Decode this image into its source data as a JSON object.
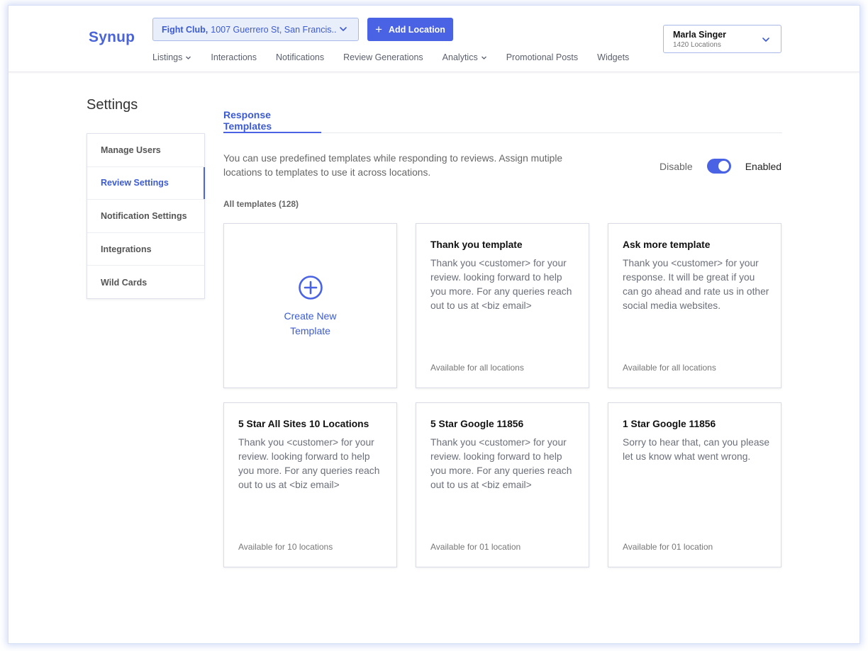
{
  "header": {
    "logo": "Synup",
    "location": {
      "name": "Fight Club,",
      "address": "1007 Guerrero St, San Francis.."
    },
    "add_location_label": "Add Location",
    "nav": [
      {
        "label": "Listings",
        "has_dropdown": true
      },
      {
        "label": "Interactions",
        "has_dropdown": false
      },
      {
        "label": "Notifications",
        "has_dropdown": false
      },
      {
        "label": "Review Generations",
        "has_dropdown": false
      },
      {
        "label": "Analytics",
        "has_dropdown": true
      },
      {
        "label": "Promotional Posts",
        "has_dropdown": false
      },
      {
        "label": "Widgets",
        "has_dropdown": false
      }
    ],
    "user": {
      "name": "Marla Singer",
      "locations": "1420 Locations"
    }
  },
  "settings": {
    "title": "Settings",
    "menu": [
      {
        "label": "Manage Users",
        "active": false
      },
      {
        "label": "Review Settings",
        "active": true
      },
      {
        "label": "Notification Settings",
        "active": false
      },
      {
        "label": "Integrations",
        "active": false
      },
      {
        "label": "Wild Cards",
        "active": false
      }
    ]
  },
  "main": {
    "tab": "Response Templates",
    "description": "You can use predefined templates while responding to reviews. Assign mutiple locations to templates to use it across locations.",
    "toggle": {
      "off_label": "Disable",
      "on_label": "Enabled",
      "enabled": true
    },
    "count_label": "All templates (128)",
    "create_label": "Create New Template",
    "templates": [
      {
        "title": "Thank you template",
        "body": "Thank you <customer> for your review. looking forward to help you more. For any queries reach out to us at <biz email>",
        "footer": "Available for all locations"
      },
      {
        "title": "Ask more template",
        "body": "Thank you <customer> for your response. It will be great if you can go ahead and rate us in other social media websites.",
        "footer": "Available for all locations"
      },
      {
        "title": "5 Star All Sites 10 Locations",
        "body": "Thank you <customer> for your review. looking forward to help you more. For any queries reach out to us at <biz email>",
        "footer": "Available for 10 locations"
      },
      {
        "title": "5 Star Google 11856",
        "body": "Thank you <customer> for your review. looking forward to help you more. For any queries reach out to us at <biz email>",
        "footer": "Available for 01 location"
      },
      {
        "title": "1 Star Google 11856",
        "body": "Sorry to hear that, can you please let us know what went wrong.",
        "footer": "Available for 01 location"
      }
    ]
  },
  "colors": {
    "accent": "#4a63e5",
    "link": "#3c5bd1",
    "select_bg": "#e9eefb"
  },
  "icons": {
    "location_dropdown": "chevron-down-icon",
    "add": "plus-icon",
    "create": "plus-circle-icon"
  }
}
